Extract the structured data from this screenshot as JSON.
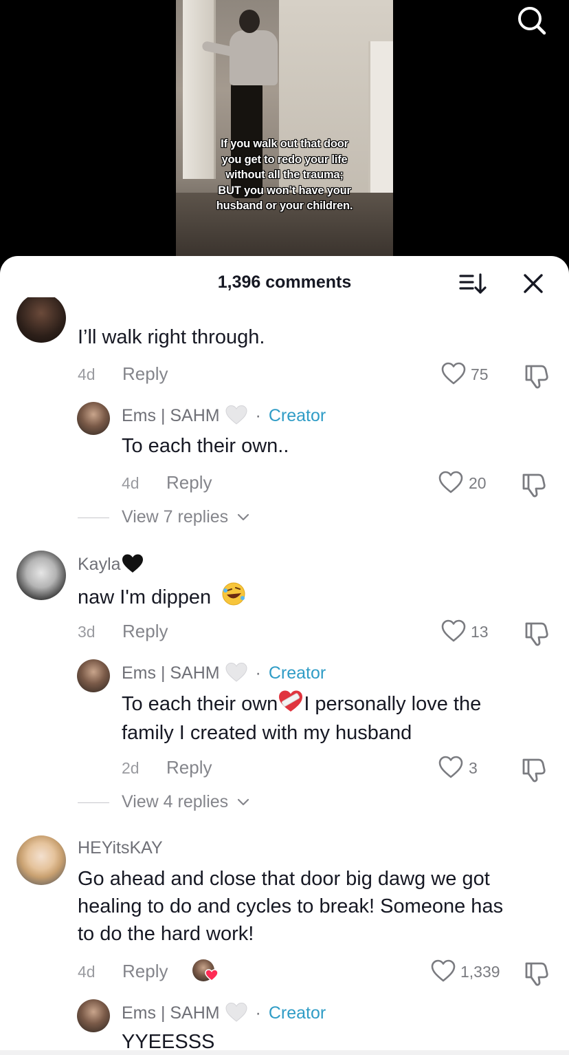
{
  "video": {
    "caption": "If you walk out that door\nyou get to redo your life\nwithout all the trauma;\nBUT you won’t have your\nhusband or your children."
  },
  "header": {
    "comment_count": "1,396 comments"
  },
  "comments": [
    {
      "username": "",
      "text": "I’ll walk right through.",
      "time": "4d",
      "reply_label": "Reply",
      "likes": "75"
    },
    {
      "username": "Ems | SAHM",
      "creator_label": "Creator",
      "separator": "·",
      "text": "To each their own..",
      "time": "4d",
      "reply_label": "Reply",
      "likes": "20",
      "view_replies": "View 7 replies"
    },
    {
      "username": "Kayla",
      "text": "naw I'm dippen",
      "time": "3d",
      "reply_label": "Reply",
      "likes": "13"
    },
    {
      "username": "Ems | SAHM",
      "creator_label": "Creator",
      "separator": "·",
      "text_part1": "To each their own",
      "text_part2": "I personally love the",
      "text_line2": "family I created with my husband",
      "time": "2d",
      "reply_label": "Reply",
      "likes": "3",
      "view_replies": "View 4 replies"
    },
    {
      "username": "HEYitsKAY",
      "text_line1": "Go ahead and close that door big dawg we got",
      "text_line2": "healing to do and cycles to break! Someone has",
      "text_line3": "to do the hard work!",
      "time": "4d",
      "reply_label": "Reply",
      "likes": "1,339"
    },
    {
      "username": "Ems | SAHM",
      "creator_label": "Creator",
      "separator": "·",
      "text": "YYEESSS"
    }
  ],
  "colors": {
    "creator": "#2f9cc6",
    "text": "#161823",
    "muted": "#84858b"
  }
}
